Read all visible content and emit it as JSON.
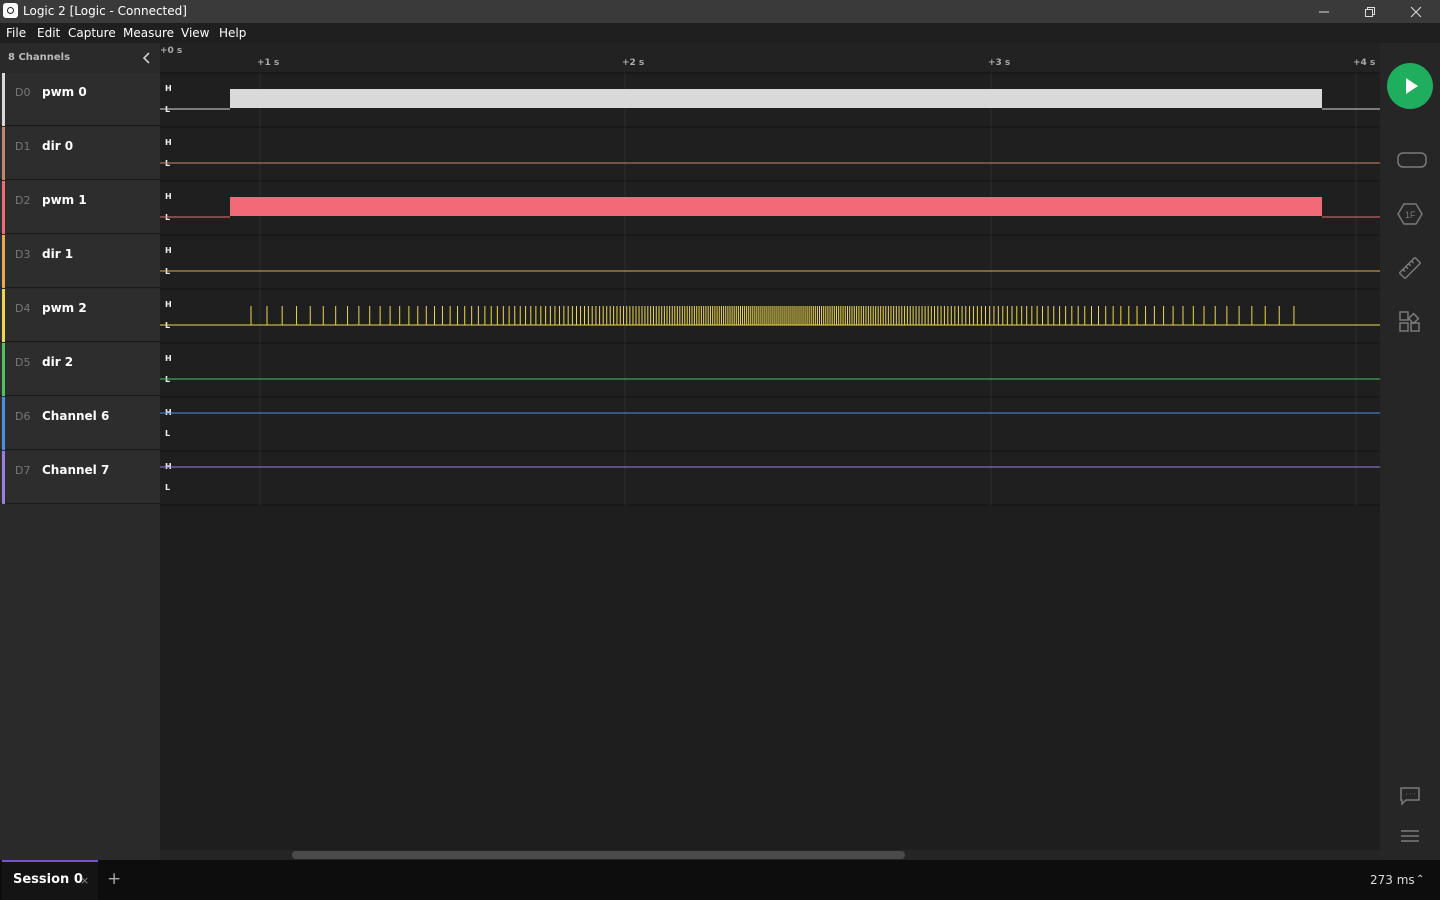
{
  "window": {
    "title": "Logic 2 [Logic - Connected]"
  },
  "menu": {
    "items": [
      "File",
      "Edit",
      "Capture",
      "Measure",
      "View",
      "Help"
    ]
  },
  "sidebar": {
    "channel_count_label": "8 Channels",
    "collapse_icon": "chevron-left-icon",
    "channels": [
      {
        "id": "D0",
        "name": "pwm 0",
        "color": "#d9d9d9"
      },
      {
        "id": "D1",
        "name": "dir 0",
        "color": "#c4876a"
      },
      {
        "id": "D2",
        "name": "pwm 1",
        "color": "#f26a78"
      },
      {
        "id": "D3",
        "name": "dir 1",
        "color": "#e8a94a"
      },
      {
        "id": "D4",
        "name": "pwm 2",
        "color": "#ecd849"
      },
      {
        "id": "D5",
        "name": "dir 2",
        "color": "#4fc15f"
      },
      {
        "id": "D6",
        "name": "Channel 6",
        "color": "#4a90e2"
      },
      {
        "id": "D7",
        "name": "Channel 7",
        "color": "#9b7fe0"
      }
    ]
  },
  "timeline": {
    "ruler_labels": [
      "+0 s",
      "+1 s",
      "+2 s",
      "+3 s",
      "+4 s"
    ],
    "level_high": "H",
    "level_low": "L"
  },
  "right_rail": {
    "start_icon": "play-icon",
    "tools": [
      "analyzer-icon",
      "trigger-icon",
      "measure-icon",
      "extensions-icon"
    ],
    "bottom_tools": [
      "chat-icon",
      "menu-icon"
    ]
  },
  "bottom_bar": {
    "session_tab": "Session 0",
    "close_glyph": "×",
    "add_glyph": "+",
    "capture_duration": "273 ms",
    "caret_glyph": "⌃"
  }
}
